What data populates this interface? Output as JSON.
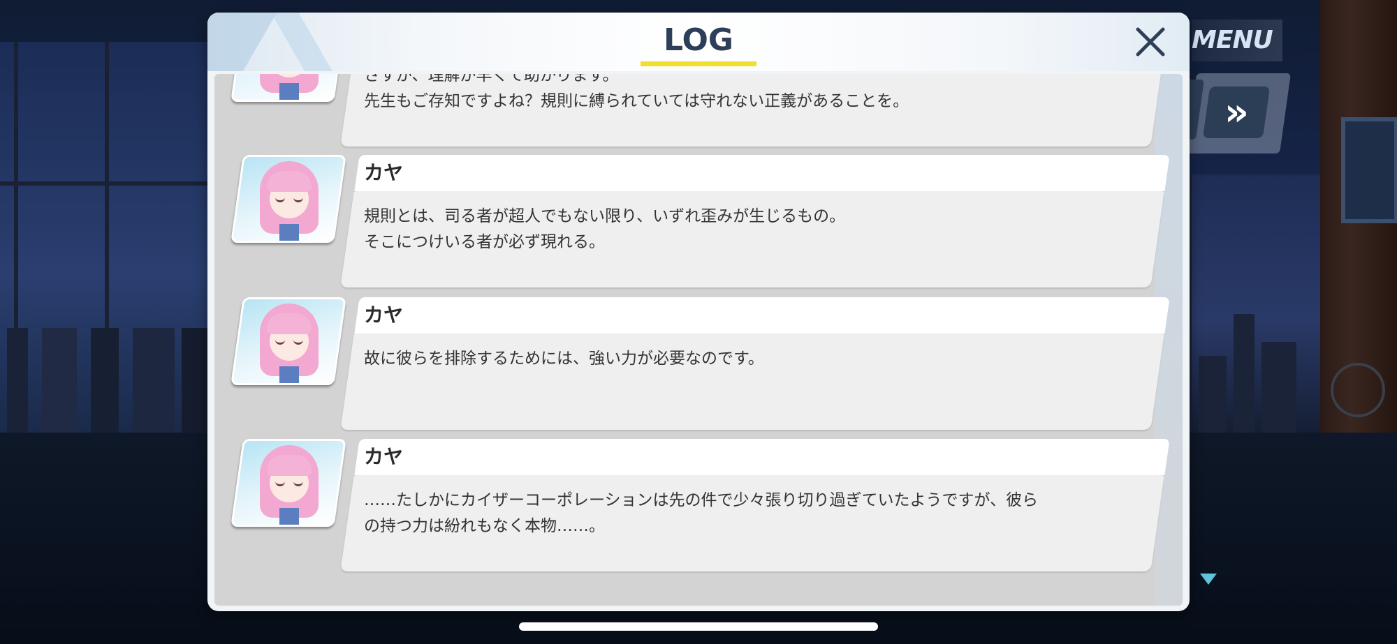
{
  "header": {
    "title": "LOG",
    "close_icon": "close-icon"
  },
  "game_controls": {
    "menu_label": "MENU",
    "skip_label": "»"
  },
  "log_entries": [
    {
      "speaker": "",
      "avatar": "kaya-portrait",
      "text": "さすが、理解が早くて助かります。\n先生もご存知ですよね？規則に縛られていては守れない正義があることを。"
    },
    {
      "speaker": "カヤ",
      "avatar": "kaya-portrait",
      "text": "規則とは、司る者が超人でもない限り、いずれ歪みが生じるもの。\nそこにつけいる者が必ず現れる。"
    },
    {
      "speaker": "カヤ",
      "avatar": "kaya-portrait",
      "text": "故に彼らを排除するためには、強い力が必要なのです。"
    },
    {
      "speaker": "カヤ",
      "avatar": "kaya-portrait",
      "text": "……たしかにカイザーコーポレーションは先の件で少々張り切り過ぎていたようですが、彼ら\nの持つ力は紛れもなく本物……。"
    }
  ],
  "colors": {
    "title_text": "#2d3e58",
    "title_underline": "#f3de2c",
    "skip_button": "#2c3d56",
    "next_indicator": "#5fc3dd"
  }
}
